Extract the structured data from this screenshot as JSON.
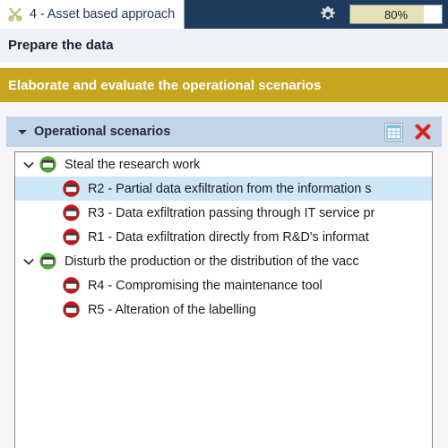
{
  "tabbar": {
    "tab_label": "4 - Asset based approach",
    "tab_icon": "crossed-tools-icon",
    "settings_icon": "gear-icon",
    "progress_value": "80%",
    "progress_percent": 80,
    "progress_fill_color": "#e8e1b8",
    "bar_color": "#1d3b5c"
  },
  "step": {
    "title": "Prepare the data",
    "background": "#eef2f7"
  },
  "banner": {
    "title": "Elaborate and evaluate the operational scenarios",
    "background": "#c7a51f",
    "text_color": "#ffffff"
  },
  "panel": {
    "title": "Operational scenarios",
    "background": "#c3d4e6",
    "collapse_icon": "triangle-down-icon",
    "grid_icon": "table-grid-icon",
    "close_icon": "red-x-icon"
  },
  "tree": {
    "rows": [
      {
        "level": 0,
        "label": "Steal the research work",
        "icon": "green-scenario-icon",
        "icon_color": "#4caf2f",
        "expanded": true,
        "selected": false,
        "twisty": "chevron-down-icon"
      },
      {
        "level": 1,
        "label": "R2 - Partial data exfiltration from the information s",
        "icon": "red-risk-icon",
        "icon_color": "#d0121b",
        "expanded": false,
        "selected": true,
        "twisty": ""
      },
      {
        "level": 1,
        "label": "R3 - Data exfiltration passing through IT service pr",
        "icon": "red-risk-icon",
        "icon_color": "#d0121b",
        "expanded": false,
        "selected": false,
        "twisty": ""
      },
      {
        "level": 1,
        "label": "R1 - Data exfiltration directly from R&D's informat",
        "icon": "red-risk-icon",
        "icon_color": "#d0121b",
        "expanded": false,
        "selected": false,
        "twisty": ""
      },
      {
        "level": 0,
        "label": "Disturb the production or the distribution of the vacc",
        "icon": "green-scenario-icon",
        "icon_color": "#4caf2f",
        "expanded": true,
        "selected": false,
        "twisty": "chevron-down-icon"
      },
      {
        "level": 1,
        "label": "R4 - Compromising the maintenance tool",
        "icon": "red-risk-icon",
        "icon_color": "#d0121b",
        "expanded": false,
        "selected": false,
        "twisty": ""
      },
      {
        "level": 1,
        "label": "R5 - Alteration of the labelling",
        "icon": "red-risk-icon",
        "icon_color": "#d0121b",
        "expanded": false,
        "selected": false,
        "twisty": ""
      }
    ]
  }
}
